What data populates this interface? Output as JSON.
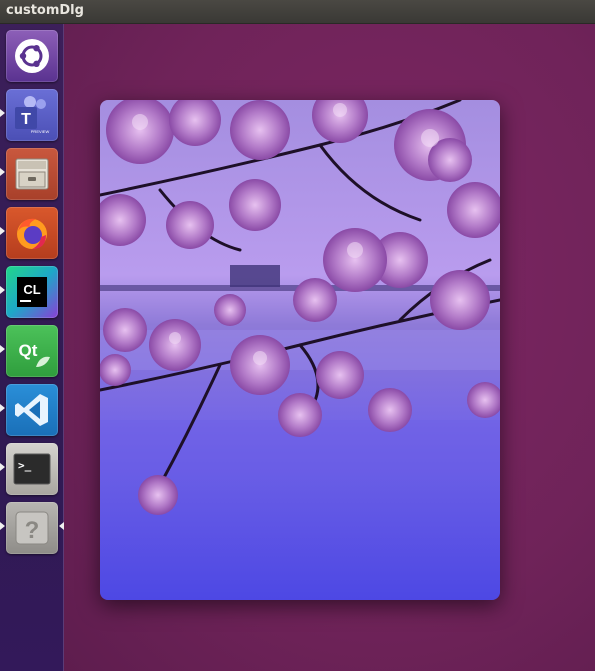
{
  "window": {
    "title": "customDlg"
  },
  "launcher": {
    "items": [
      {
        "name": "ubuntu-dash",
        "label": ""
      },
      {
        "name": "teams",
        "label": "T",
        "badge": "PREVIEW"
      },
      {
        "name": "files",
        "label": ""
      },
      {
        "name": "firefox",
        "label": ""
      },
      {
        "name": "clion",
        "label": "CL"
      },
      {
        "name": "qt-creator",
        "label": "Qt"
      },
      {
        "name": "vscode",
        "label": ""
      },
      {
        "name": "terminal",
        "label": ">_"
      },
      {
        "name": "unknown-app",
        "label": "?"
      }
    ]
  },
  "dialog": {
    "image": "cherry-blossom-photo"
  }
}
